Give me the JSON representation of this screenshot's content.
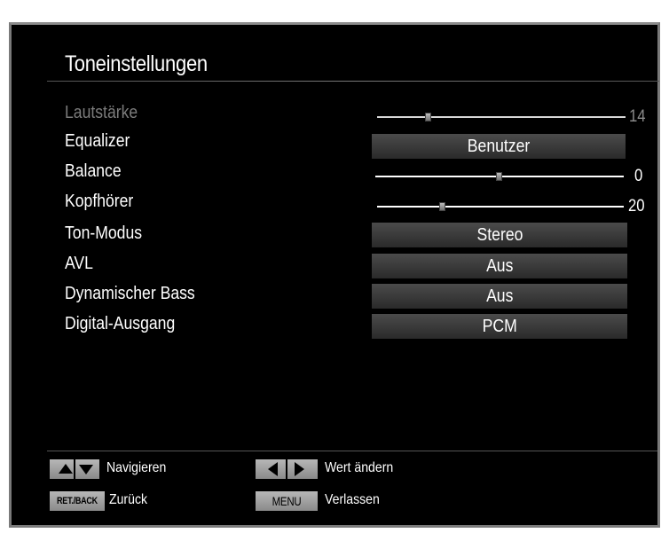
{
  "menu": {
    "title": "Toneinstellungen",
    "items": [
      {
        "label": "Lautstärke",
        "type": "slider",
        "value": "14",
        "level": 0.2
      },
      {
        "label": "Equalizer",
        "type": "option",
        "value": "Benutzer"
      },
      {
        "label": "Balance",
        "type": "slider",
        "value": "0",
        "level": 0.5
      },
      {
        "label": "Kopfhörer",
        "type": "slider",
        "value": "20",
        "level": 0.26
      },
      {
        "label": "Ton-Modus",
        "type": "option",
        "value": "Stereo"
      },
      {
        "label": "AVL",
        "type": "option",
        "value": "Aus"
      },
      {
        "label": "Dynamischer Bass",
        "type": "option",
        "value": "Aus"
      },
      {
        "label": "Digital-Ausgang",
        "type": "option",
        "value": "PCM"
      }
    ]
  },
  "footer": {
    "navigate_label": "Navigieren",
    "change_value_label": "Wert ändern",
    "back_key": "RET./BACK",
    "back_label": "Zurück",
    "menu_key": "MENU",
    "exit_label": "Verlassen"
  },
  "colors": {
    "background": "#000000",
    "text": "#ffffff",
    "disabled_text": "#7c7c7c",
    "option_box": "#3a3a3a",
    "key_button": "#a0a0a0"
  }
}
